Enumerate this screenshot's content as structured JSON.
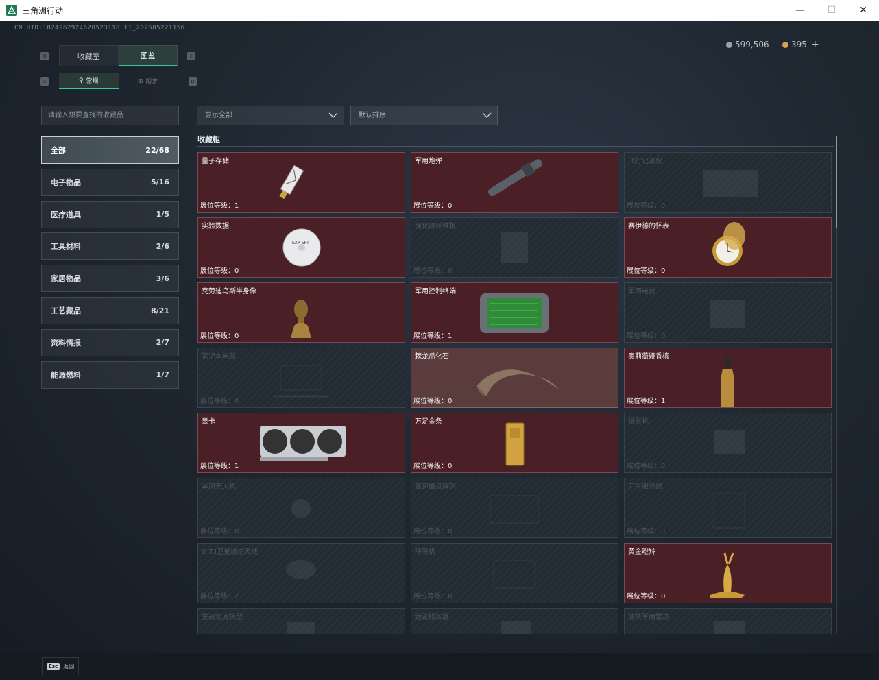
{
  "window": {
    "title": "三角洲行动",
    "minimize": "—",
    "maximize": "☐",
    "close": "✕"
  },
  "uid": "CN UID:1824962924620523118 11_202605221156",
  "currency": [
    {
      "value": "599,506",
      "color": "#9aa3ab"
    },
    {
      "value": "395",
      "color": "#d8a24a"
    }
  ],
  "currency_plus": "+",
  "keyhints": {
    "q": "Q",
    "e": "E",
    "a": "A",
    "d": "D"
  },
  "tabs": [
    {
      "label": "收藏室",
      "active": false
    },
    {
      "label": "图鉴",
      "active": true
    }
  ],
  "subtabs": [
    {
      "label": "常规",
      "active": true
    },
    {
      "label": "限定",
      "active": false
    }
  ],
  "search": {
    "placeholder": "请输入想要查找的收藏品"
  },
  "categories": [
    {
      "label": "全部",
      "count": "22/68",
      "active": true
    },
    {
      "label": "电子物品",
      "count": "5/16"
    },
    {
      "label": "医疗道具",
      "count": "1/5"
    },
    {
      "label": "工具材料",
      "count": "2/6"
    },
    {
      "label": "家居物品",
      "count": "3/6"
    },
    {
      "label": "工艺藏品",
      "count": "8/21"
    },
    {
      "label": "资料情报",
      "count": "2/7"
    },
    {
      "label": "能源燃料",
      "count": "1/7"
    }
  ],
  "filters": {
    "show": "显示全部",
    "sort": "默认排序"
  },
  "section_title": "收藏柜",
  "items": [
    {
      "name": "量子存储",
      "level": "展位等级：1",
      "owned": true,
      "icon": "usb-drive-icon"
    },
    {
      "name": "军用炮弹",
      "level": "展位等级：0",
      "owned": true,
      "icon": "artillery-shell-icon"
    },
    {
      "name": "飞行记录仪",
      "level": "展位等级：0",
      "owned": false,
      "icon": "flight-recorder-icon"
    },
    {
      "name": "实验数据",
      "level": "展位等级：0",
      "owned": true,
      "icon": "disc-icon"
    },
    {
      "name": "强化碳纤维板",
      "level": "展位等级：0",
      "owned": false,
      "icon": "carbon-plate-icon"
    },
    {
      "name": "赛伊德的怀表",
      "level": "展位等级：0",
      "owned": true,
      "icon": "pocket-watch-icon"
    },
    {
      "name": "克劳迪乌斯半身像",
      "level": "展位等级：0",
      "owned": true,
      "icon": "bust-icon"
    },
    {
      "name": "军用控制终端",
      "level": "展位等级：1",
      "owned": true,
      "icon": "control-terminal-icon"
    },
    {
      "name": "军用电台",
      "level": "展位等级：0",
      "owned": false,
      "icon": "radio-icon"
    },
    {
      "name": "笔记本电脑",
      "level": "展位等级：0",
      "owned": false,
      "icon": "laptop-icon"
    },
    {
      "name": "棘龙爪化石",
      "level": "展位等级：0",
      "owned": true,
      "light": true,
      "icon": "claw-fossil-icon"
    },
    {
      "name": "奥莉薇娅香槟",
      "level": "展位等级：1",
      "owned": true,
      "icon": "champagne-icon"
    },
    {
      "name": "显卡",
      "level": "展位等级：1",
      "owned": true,
      "icon": "graphics-card-icon"
    },
    {
      "name": "万足金条",
      "level": "展位等级：0",
      "owned": true,
      "icon": "gold-bar-icon"
    },
    {
      "name": "摄影机",
      "level": "展位等级：0",
      "owned": false,
      "icon": "camera-icon"
    },
    {
      "name": "军用无人机",
      "level": "展位等级：0",
      "owned": false,
      "icon": "drone-icon"
    },
    {
      "name": "高速磁盘阵列",
      "level": "展位等级：0",
      "owned": false,
      "icon": "disk-array-icon"
    },
    {
      "name": "刀片服务器",
      "level": "展位等级：0",
      "owned": false,
      "icon": "blade-server-icon"
    },
    {
      "name": "G.T.I卫星通信天线",
      "level": "展位等级：2",
      "owned": false,
      "icon": "satellite-dish-icon"
    },
    {
      "name": "呼吸机",
      "level": "展位等级：0",
      "owned": false,
      "icon": "ventilator-icon"
    },
    {
      "name": "黄金瞪羚",
      "level": "展位等级：0",
      "owned": true,
      "icon": "gold-gazelle-icon"
    },
    {
      "name": "主战坦克模型",
      "level": "",
      "owned": false,
      "icon": "tank-model-icon"
    },
    {
      "name": "绝密服务器",
      "level": "",
      "owned": false,
      "icon": "server-icon"
    },
    {
      "name": "便携军用雷达",
      "level": "",
      "owned": false,
      "icon": "radar-icon"
    }
  ],
  "footer": {
    "key": "Esc",
    "label": "返回"
  }
}
